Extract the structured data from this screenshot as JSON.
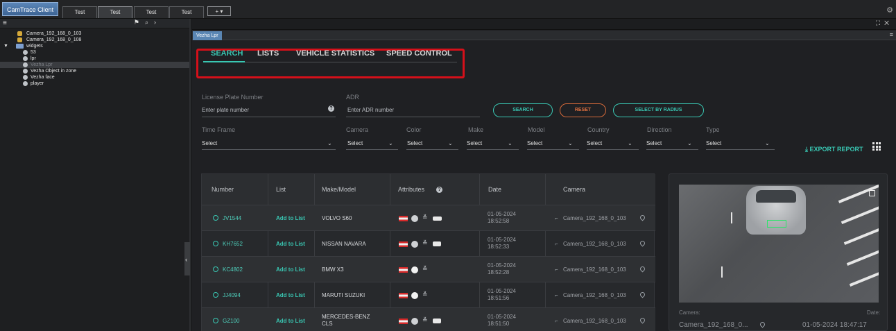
{
  "window": {
    "app_title": "CamTrace Client",
    "tabs": [
      "Test",
      "Test",
      "Test",
      "Test"
    ],
    "add_tab_label": "+ ▾"
  },
  "left_panel": {
    "tree": [
      {
        "label": "Camera_192_168_0_103",
        "icon": "camera-icon"
      },
      {
        "label": "Camera_192_168_0_108",
        "icon": "camera-icon"
      },
      {
        "label": "widgets",
        "icon": "folder-icon"
      },
      {
        "label": "53",
        "icon": "globe-icon"
      },
      {
        "label": "lpr",
        "icon": "globe-icon"
      },
      {
        "label": "Vezha Lpr",
        "icon": "globe-icon"
      },
      {
        "label": "Vezha Object in zone",
        "icon": "globe-icon"
      },
      {
        "label": "Vezha face",
        "icon": "globe-icon"
      },
      {
        "label": "player",
        "icon": "globe-icon"
      }
    ]
  },
  "pane": {
    "tab_label": "Vezha Lpr"
  },
  "nav": {
    "tabs": [
      "SEARCH",
      "LISTS",
      "VEHICLE STATISTICS",
      "SPEED CONTROL"
    ]
  },
  "filters": {
    "plate_label": "License Plate Number",
    "plate_placeholder": "Enter plate number",
    "adr_label": "ADR",
    "adr_placeholder": "Enter ADR number",
    "search_btn": "SEARCH",
    "reset_btn": "RESET",
    "radius_btn": "SELECT BY RADIUS",
    "selects": [
      {
        "label": "Time Frame",
        "value": "Select"
      },
      {
        "label": "Camera",
        "value": "Select"
      },
      {
        "label": "Color",
        "value": "Select"
      },
      {
        "label": "Make",
        "value": "Select"
      },
      {
        "label": "Model",
        "value": "Select"
      },
      {
        "label": "Country",
        "value": "Select"
      },
      {
        "label": "Direction",
        "value": "Select"
      },
      {
        "label": "Type",
        "value": "Select"
      }
    ],
    "export_label": "EXPORT REPORT"
  },
  "table": {
    "headers": [
      "Number",
      "List",
      "Make/Model",
      "Attributes",
      "Date",
      "Camera"
    ],
    "rows": [
      {
        "number": "JV1544",
        "list": "Add to List",
        "make": "VOLVO S60",
        "make2": "",
        "date": "01-05-2024",
        "time": "18:52:58",
        "camera": "Camera_192_168_0_103",
        "color": "grey",
        "vehicle": "car"
      },
      {
        "number": "KH7652",
        "list": "Add to List",
        "make": "NISSAN NAVARA",
        "make2": "",
        "date": "01-05-2024",
        "time": "18:52:33",
        "camera": "Camera_192_168_0_103",
        "color": "grey",
        "vehicle": "truck"
      },
      {
        "number": "KC4802",
        "list": "Add to List",
        "make": "BMW X3",
        "make2": "",
        "date": "01-05-2024",
        "time": "18:52:28",
        "camera": "Camera_192_168_0_103",
        "color": "white",
        "vehicle": ""
      },
      {
        "number": "JJ4094",
        "list": "Add to List",
        "make": "MARUTI SUZUKI",
        "make2": "",
        "date": "01-05-2024",
        "time": "18:51:56",
        "camera": "Camera_192_168_0_103",
        "color": "white",
        "vehicle": ""
      },
      {
        "number": "GZ100",
        "list": "Add to List",
        "make": "MERCEDES-BENZ",
        "make2": "CLS",
        "date": "01-05-2024",
        "time": "18:51:50",
        "camera": "Camera_192_168_0_103",
        "color": "grey",
        "vehicle": "truck"
      }
    ]
  },
  "preview": {
    "camera_label": "Camera:",
    "camera_value": "Camera_192_168_0...",
    "date_label": "Date:",
    "date_value": "01-05-2024 18:47:17"
  },
  "colors": {
    "accent": "#39c7b3",
    "reset": "#e0703f",
    "highlight_box": "#d5101a"
  }
}
